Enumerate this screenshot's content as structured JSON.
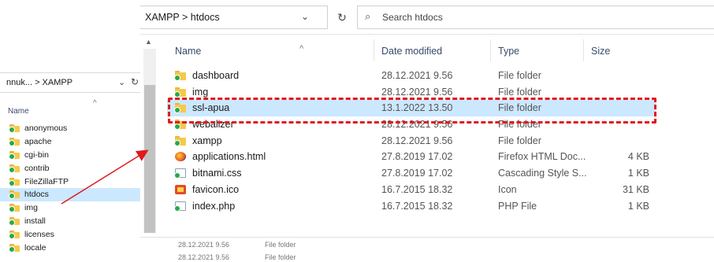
{
  "background_window": {
    "breadcrumb": "nnuk...  >  XAMPP",
    "column_name": "Name",
    "items": [
      {
        "name": "anonymous",
        "selected": false
      },
      {
        "name": "apache",
        "selected": false
      },
      {
        "name": "cgi-bin",
        "selected": false
      },
      {
        "name": "contrib",
        "selected": false
      },
      {
        "name": "FileZillaFTP",
        "selected": false
      },
      {
        "name": "htdocs",
        "selected": true,
        "trail": "r"
      },
      {
        "name": "img",
        "selected": false
      },
      {
        "name": "install",
        "selected": false
      },
      {
        "name": "licenses",
        "selected": false
      },
      {
        "name": "locale",
        "selected": false
      }
    ]
  },
  "foreground_window": {
    "breadcrumb": "XAMPP  >  htdocs",
    "search_placeholder": "Search htdocs",
    "columns": {
      "name": "Name",
      "date": "Date modified",
      "type": "Type",
      "size": "Size"
    },
    "rows": [
      {
        "name": "dashboard",
        "date": "28.12.2021 9.56",
        "type": "File folder",
        "size": "",
        "icon": "folder-icon",
        "highlight": false
      },
      {
        "name": "img",
        "date": "28.12.2021 9.56",
        "type": "File folder",
        "size": "",
        "icon": "folder-icon",
        "highlight": false
      },
      {
        "name": "ssl-apua",
        "date": "13.1.2022 13.50",
        "type": "File folder",
        "size": "",
        "icon": "folder-icon",
        "highlight": true
      },
      {
        "name": "webalizer",
        "date": "28.12.2021 9.56",
        "type": "File folder",
        "size": "",
        "icon": "folder-icon",
        "highlight": false
      },
      {
        "name": "xampp",
        "date": "28.12.2021 9.56",
        "type": "File folder",
        "size": "",
        "icon": "folder-icon",
        "highlight": false
      },
      {
        "name": "applications.html",
        "date": "27.8.2019 17.02",
        "type": "Firefox HTML Doc...",
        "size": "4 KB",
        "icon": "firefox-html-icon",
        "highlight": false
      },
      {
        "name": "bitnami.css",
        "date": "27.8.2019 17.02",
        "type": "Cascading Style S...",
        "size": "1 KB",
        "icon": "css-file-icon",
        "highlight": false
      },
      {
        "name": "favicon.ico",
        "date": "16.7.2015 18.32",
        "type": "Icon",
        "size": "31 KB",
        "icon": "ico-file-icon",
        "highlight": false
      },
      {
        "name": "index.php",
        "date": "16.7.2015 18.32",
        "type": "PHP File",
        "size": "1 KB",
        "icon": "php-file-icon",
        "highlight": false
      }
    ],
    "bottom_rows": [
      {
        "date": "28.12.2021 9.56",
        "type": "File folder"
      },
      {
        "date": "28.12.2021 9.56",
        "type": "File folder"
      }
    ]
  },
  "colors": {
    "selection": "#cce8ff",
    "annotation": "#e0191f",
    "folder": "#f6c94b",
    "badge": "#2aa84a"
  }
}
